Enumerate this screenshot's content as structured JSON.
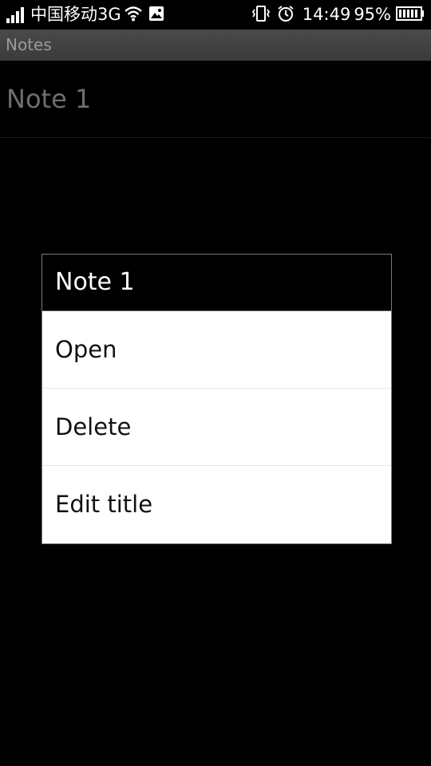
{
  "status_bar": {
    "carrier": "中国移动3G",
    "time": "14:49",
    "battery": "95%",
    "icons": {
      "signal": "signal-icon",
      "wifi": "wifi-icon",
      "gallery": "gallery-icon",
      "vibrate": "vibrate-icon",
      "alarm": "alarm-icon",
      "battery": "battery-icon"
    }
  },
  "app_bar": {
    "title": "Notes"
  },
  "notes": [
    {
      "title": "Note 1"
    }
  ],
  "context_menu": {
    "title": "Note 1",
    "items": [
      {
        "label": "Open"
      },
      {
        "label": "Delete"
      },
      {
        "label": "Edit title"
      }
    ]
  },
  "colors": {
    "background": "#000000",
    "title_bar": "#404040",
    "dialog_background": "#ffffff",
    "dialog_header": "#000000"
  }
}
